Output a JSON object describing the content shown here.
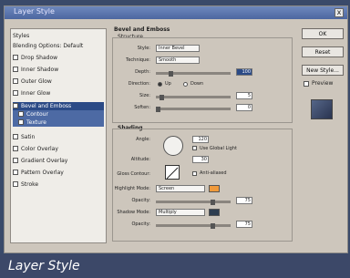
{
  "dialog": {
    "title": "Layer Style",
    "close": "x"
  },
  "styles_list": {
    "items": [
      {
        "label": "Styles",
        "checkbox": false,
        "state": "normal"
      },
      {
        "label": "Blending Options: Default",
        "checkbox": false,
        "state": "normal"
      },
      {
        "label": "Drop Shadow",
        "checkbox": true,
        "state": "normal"
      },
      {
        "label": "Inner Shadow",
        "checkbox": true,
        "state": "normal"
      },
      {
        "label": "Outer Glow",
        "checkbox": true,
        "state": "normal"
      },
      {
        "label": "Inner Glow",
        "checkbox": true,
        "state": "normal"
      },
      {
        "label": "Bevel and Emboss",
        "checkbox": true,
        "state": "selected"
      },
      {
        "label": "Contour",
        "checkbox": true,
        "state": "sub"
      },
      {
        "label": "Texture",
        "checkbox": true,
        "state": "sub"
      },
      {
        "label": "Satin",
        "checkbox": true,
        "state": "normal"
      },
      {
        "label": "Color Overlay",
        "checkbox": true,
        "state": "normal"
      },
      {
        "label": "Gradient Overlay",
        "checkbox": true,
        "state": "normal"
      },
      {
        "label": "Pattern Overlay",
        "checkbox": true,
        "state": "normal"
      },
      {
        "label": "Stroke",
        "checkbox": true,
        "state": "normal"
      }
    ]
  },
  "structure": {
    "title": "Bevel and Emboss",
    "subtitle": "Structure",
    "style_label": "Style:",
    "style_value": "Inner Bevel",
    "technique_label": "Technique:",
    "technique_value": "Smooth",
    "depth_label": "Depth:",
    "depth_value": "100",
    "direction_label": "Direction:",
    "up_label": "Up",
    "down_label": "Down",
    "size_label": "Size:",
    "size_value": "5",
    "soften_label": "Soften:",
    "soften_value": "0"
  },
  "shading": {
    "title": "Shading",
    "angle_label": "Angle:",
    "angle_value": "120",
    "global_light_label": "Use Global Light",
    "altitude_label": "Altitude:",
    "altitude_value": "30",
    "gloss_label": "Gloss Contour:",
    "antialias_label": "Anti-aliased",
    "highlight_label": "Highlight Mode:",
    "highlight_value": "Screen",
    "highlight_opacity_label": "Opacity:",
    "highlight_opacity_value": "75",
    "shadow_label": "Shadow Mode:",
    "shadow_value": "Multiply",
    "shadow_opacity_label": "Opacity:",
    "shadow_opacity_value": "75"
  },
  "buttons": {
    "ok": "OK",
    "cancel": "Reset",
    "new_style": "New Style...",
    "preview": "Preview"
  },
  "caption": "Layer Style",
  "colors": {
    "caption_bg": "#3c4868",
    "selection": "#2b4a86",
    "highlight_swatch": "#f09a3c",
    "shadow_swatch": "#2e3e50"
  }
}
